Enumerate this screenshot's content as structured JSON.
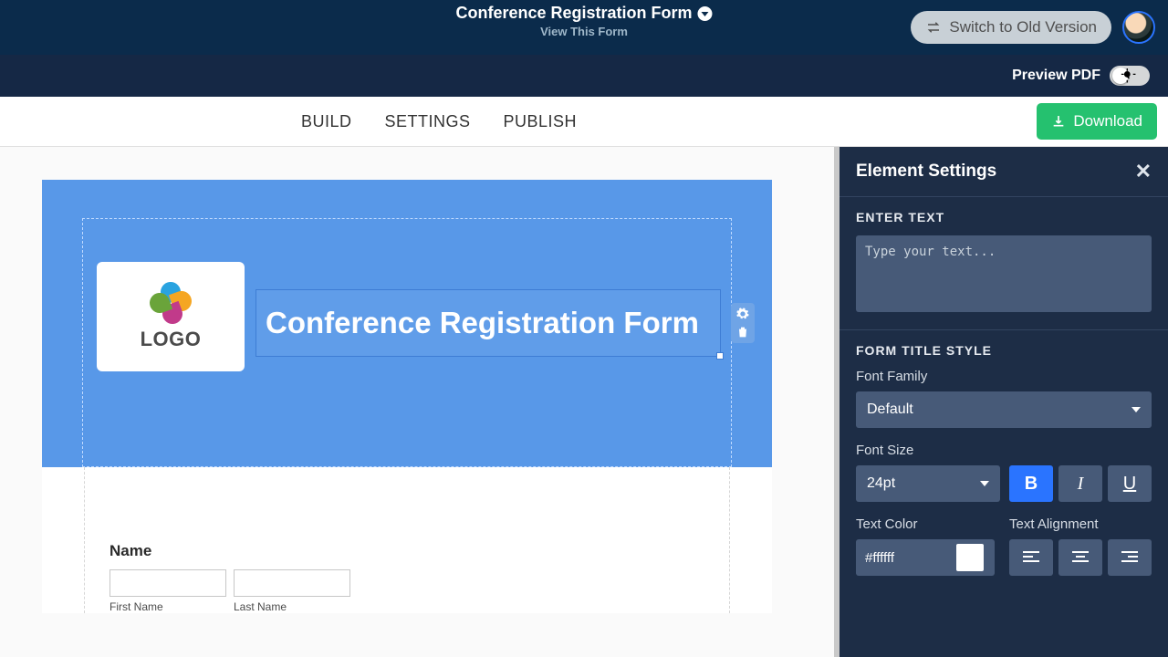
{
  "topbar": {
    "title": "Conference Registration Form",
    "view_label": "View This Form",
    "switch_label": "Switch to Old Version"
  },
  "subbar": {
    "preview_pdf_label": "Preview PDF"
  },
  "tabs": [
    {
      "label": "BUILD"
    },
    {
      "label": "SETTINGS"
    },
    {
      "label": "PUBLISH"
    }
  ],
  "download_label": "Download",
  "form": {
    "logo_text": "LOGO",
    "title": "Conference Registration Form",
    "name_heading": "Name",
    "first_name_label": "First Name",
    "last_name_label": "Last Name"
  },
  "panel": {
    "heading": "Element Settings",
    "enter_text_label": "ENTER TEXT",
    "textarea_placeholder": "Type your text...",
    "style_heading": "FORM TITLE STYLE",
    "font_family_label": "Font Family",
    "font_family_value": "Default",
    "font_size_label": "Font Size",
    "font_size_value": "24pt",
    "text_color_label": "Text Color",
    "text_color_value": "#ffffff",
    "text_align_label": "Text Alignment"
  }
}
